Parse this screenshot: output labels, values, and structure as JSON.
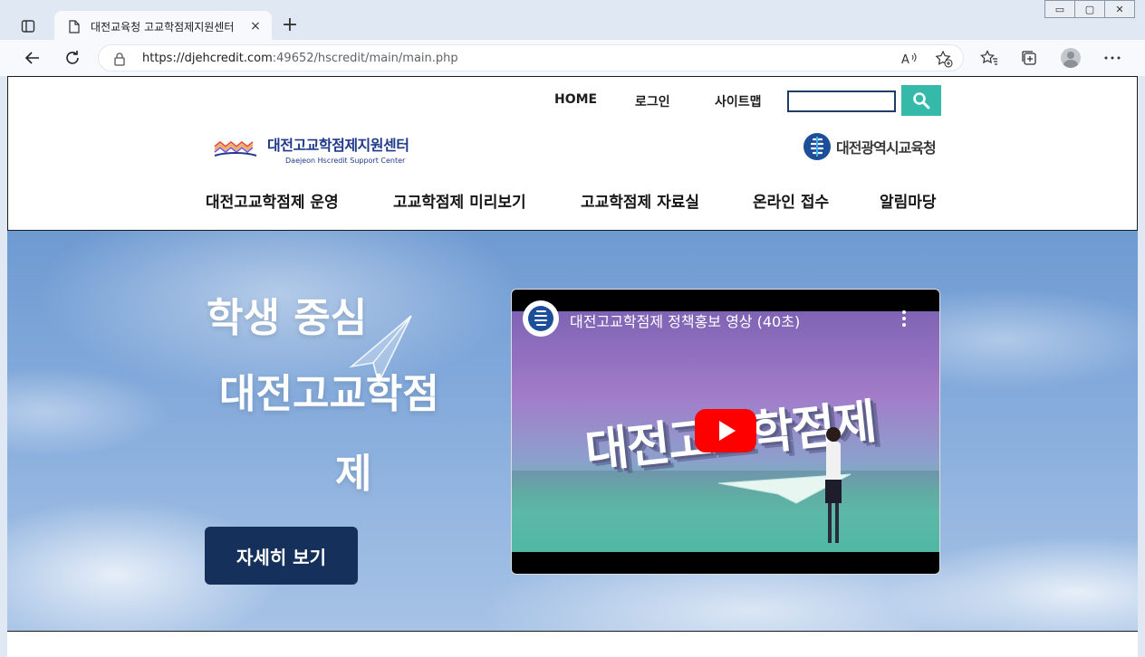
{
  "browser": {
    "tab_title": "대전교육청 고교학점제지원센터",
    "tab_close": "×",
    "new_tab": "+",
    "url_host": "https://djehcredit.com",
    "url_rest": ":49652/hscredit/main/main.php",
    "read_aloud_icon": "read-aloud-icon",
    "window_controls": [
      "▭",
      "▢",
      "✕"
    ]
  },
  "header": {
    "util_nav": [
      "HOME",
      "로그인",
      "사이트맵"
    ],
    "search": {
      "value": "",
      "placeholder": ""
    },
    "logo_ko": "대전고교학점제지원센터",
    "logo_en": "Daejeon Hscredit Support Center",
    "edu_office": "대전광역시교육청",
    "main_nav": [
      "대전고교학점제 운영",
      "고교학점제 미리보기",
      "고교학점제 자료실",
      "온라인 접수",
      "알림마당"
    ]
  },
  "hero": {
    "line1": "학생 중심",
    "line2": "대전고교학점",
    "line3": "제",
    "cta_label": "자세히 보기"
  },
  "video": {
    "title": "대전고교학점제 정책홍보 영상 (40초)",
    "thumb_text": "대전고교학점제"
  },
  "colors": {
    "accent_teal": "#35b9a8",
    "cta_navy": "#15305a",
    "logo_blue": "#1f3a8a",
    "youtube_red": "#ff0000"
  }
}
